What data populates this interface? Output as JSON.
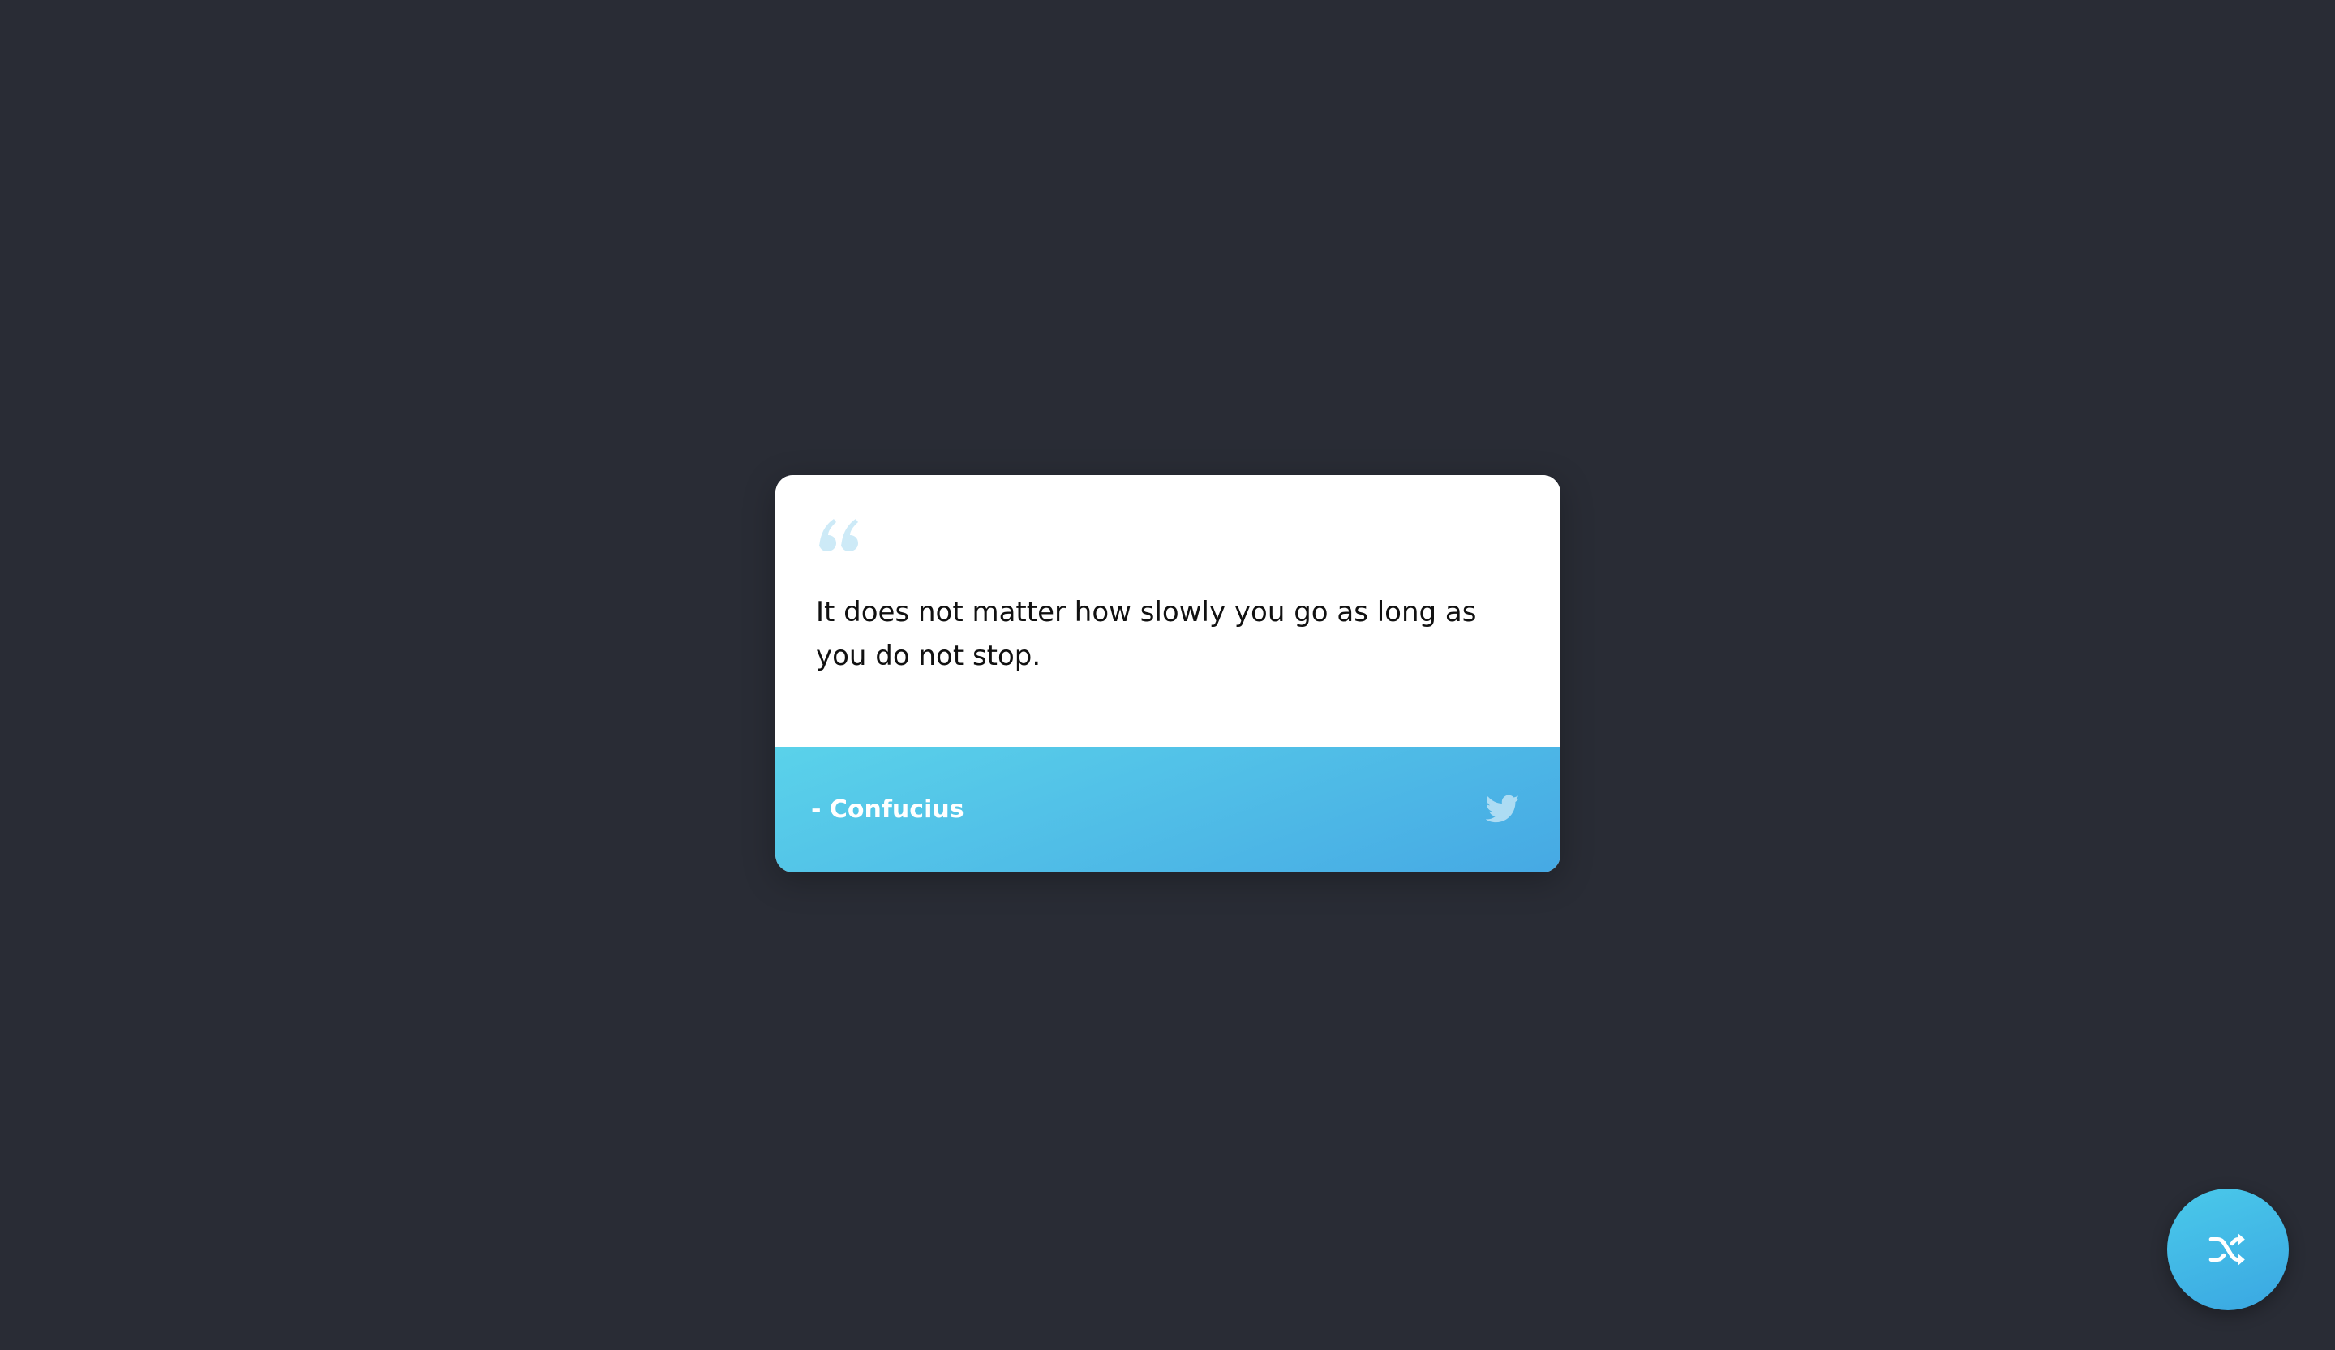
{
  "quote": {
    "text": "It does not matter how slowly you go as long as you do not stop.",
    "author": "- Confucius"
  },
  "icons": {
    "quote_mark": "quote-left-icon",
    "tweet": "twitter-icon",
    "shuffle": "shuffle-icon"
  },
  "colors": {
    "background": "#292c35",
    "card": "#ffffff",
    "accent_start": "#5ad2ea",
    "accent_end": "#46a9e4",
    "quote_mark": "#cdeaf7"
  }
}
